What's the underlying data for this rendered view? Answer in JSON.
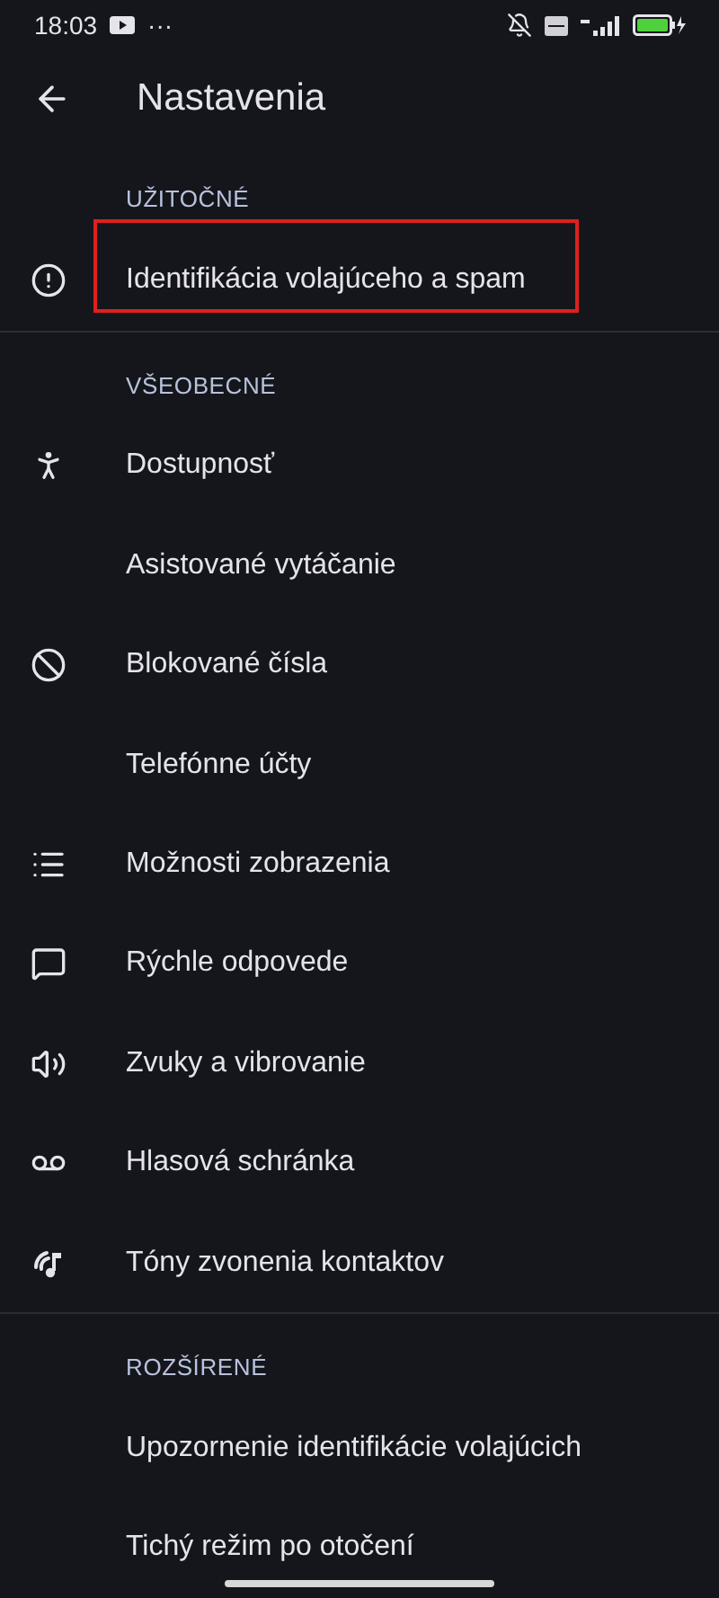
{
  "status_bar": {
    "time": "18:03",
    "more": "···"
  },
  "header": {
    "title": "Nastavenia"
  },
  "sections": [
    {
      "title": "UŽITOČNÉ",
      "items": [
        {
          "label": "Identifikácia volajúceho a spam",
          "highlighted": true
        }
      ]
    },
    {
      "title": "VŠEOBECNÉ",
      "items": [
        {
          "label": "Dostupnosť",
          "highlighted": false
        },
        {
          "label": "Asistované vytáčanie",
          "highlighted": false
        },
        {
          "label": "Blokované čísla",
          "highlighted": false
        },
        {
          "label": "Telefónne účty",
          "highlighted": false
        },
        {
          "label": "Možnosti zobrazenia",
          "highlighted": false
        },
        {
          "label": "Rýchle odpovede",
          "highlighted": false
        },
        {
          "label": "Zvuky a vibrovanie",
          "highlighted": false
        },
        {
          "label": "Hlasová schránka",
          "highlighted": false
        },
        {
          "label": "Tóny zvonenia kontaktov",
          "highlighted": false
        }
      ]
    },
    {
      "title": "ROZŠÍRENÉ",
      "items": [
        {
          "label": "Upozornenie identifikácie volajúcich",
          "highlighted": false
        },
        {
          "label": "Tichý režim po otočení",
          "highlighted": false
        }
      ]
    }
  ]
}
